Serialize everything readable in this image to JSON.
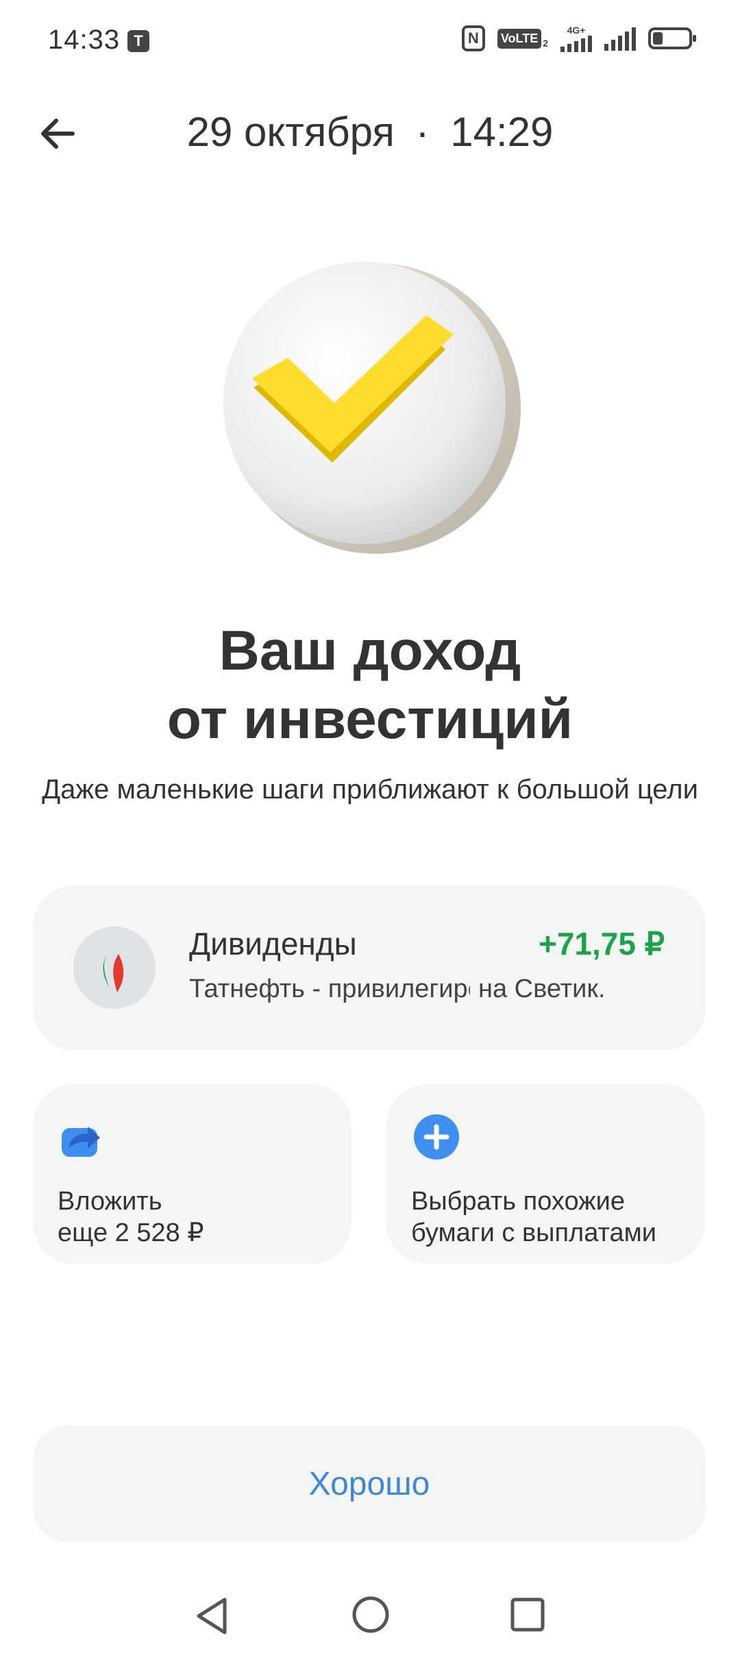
{
  "status_bar": {
    "time": "14:33",
    "carrier_icon_letter": "T",
    "volte_label": "VoLTE",
    "sim2": "2",
    "network": "4G+"
  },
  "header": {
    "date": "29 октября",
    "separator": "·",
    "time": "14:29"
  },
  "hero": {
    "title": "Ваш доход\nот инвестиций",
    "subtitle": "Даже маленькие шаги приближают к большой цели"
  },
  "dividend": {
    "title": "Дивиденды",
    "amount": "+71,75 ₽",
    "description_prefix": "Татнефть - привилегиро",
    "description_suffix": "на Светик.",
    "amount_color": "#1aa34a"
  },
  "actions": {
    "invest_label": "Вложить\nеще 2 528 ₽",
    "similar_label": "Выбрать похожие\nбумаги с выплатами"
  },
  "ok_button": {
    "label": "Хорошо",
    "color": "#3f87d8"
  },
  "colors": {
    "accent_yellow": "#ffdd2d",
    "link_blue": "#3f87d8",
    "card_bg": "#f4f6f5"
  }
}
